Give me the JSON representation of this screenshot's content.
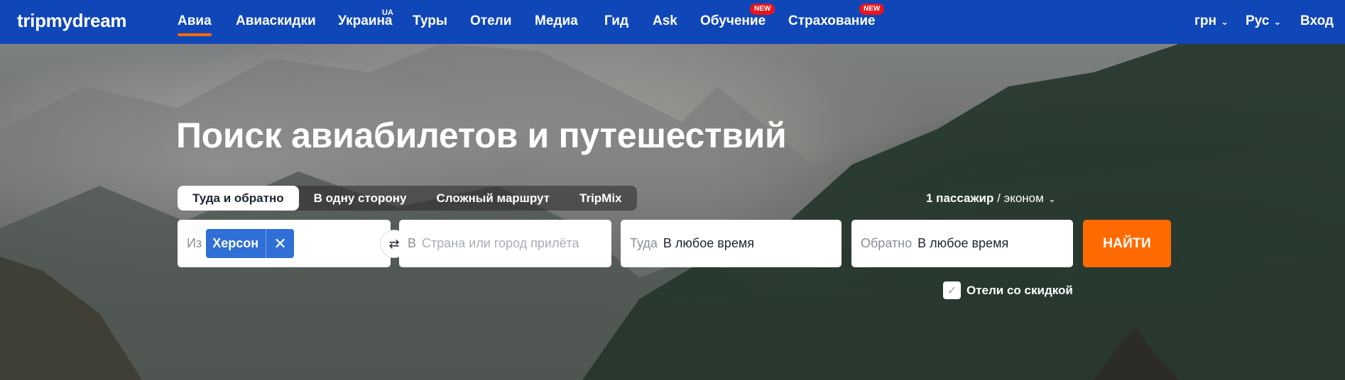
{
  "nav": {
    "logo": "tripmydream",
    "items": [
      {
        "label": "Авиа"
      },
      {
        "label": "Авиаскидки"
      },
      {
        "label": "Украина",
        "sup": "UA"
      },
      {
        "label": "Туры"
      },
      {
        "label": "Отели"
      },
      {
        "label": "Медиа"
      },
      {
        "label": "Гид"
      },
      {
        "label": "Ask"
      },
      {
        "label": "Обучение",
        "badge": "NEW"
      },
      {
        "label": "Страхование",
        "badge": "NEW"
      }
    ],
    "currency": "грн",
    "language": "Рус",
    "login": "Вход"
  },
  "hero": {
    "headline": "Поиск авиабилетов и путешествий",
    "tabs": [
      "Туда и обратно",
      "В одну сторону",
      "Сложный маршрут",
      "TripMix"
    ],
    "passengers_count": "1 пассажир",
    "passengers_sep": " / ",
    "passengers_class": "эконом",
    "from_label": "Из",
    "from_value": "Херсон",
    "chip_remove": "✕",
    "swap_icon": "⇄",
    "to_label": "В",
    "to_placeholder": "Страна или город прилёта",
    "depart_label": "Туда",
    "depart_value": "В любое время",
    "return_label": "Обратно",
    "return_value": "В любое время",
    "search_button": "НАЙТИ",
    "hotels_checkbox": "Отели со скидкой",
    "check_mark": "✓"
  },
  "colors": {
    "nav_bg": "#1047b8",
    "accent": "#ff6a00",
    "chip": "#2f6fd6",
    "badge": "#e8141e"
  }
}
